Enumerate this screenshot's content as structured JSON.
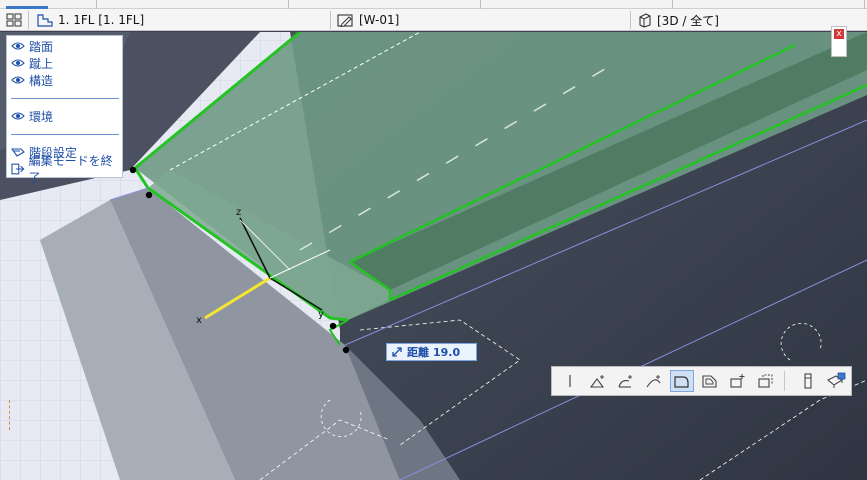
{
  "tabbar": {
    "story_label": "1. 1FL [1. 1FL]",
    "wall_label": "[W-01]",
    "view_label": "[3D / 全て]"
  },
  "panel": {
    "items": [
      {
        "label": "踏面"
      },
      {
        "label": "蹴上"
      },
      {
        "label": "構造"
      },
      {
        "label": "環境"
      },
      {
        "label": "階段設定"
      },
      {
        "label": "編集モードを終了"
      }
    ]
  },
  "close_label": "x",
  "tracker": {
    "label": "距離",
    "value": "19.0"
  },
  "axes": {
    "x": "x",
    "y": "y",
    "z": "z"
  },
  "toolbar": {
    "icons": [
      "straight-segment-icon",
      "arc-center-icon",
      "arc-tangent-icon",
      "arc-three-point-icon",
      "offset-edge-icon",
      "fillet-icon",
      "add-vertex-icon",
      "delete-vertex-icon",
      "rise-icon",
      "landing-icon"
    ],
    "active_index": 4
  },
  "colors": {
    "selection": "#22c322",
    "panel_text": "#1f4fa8",
    "tracker_border": "#7aa3df",
    "axis_x": "#f3e530"
  }
}
